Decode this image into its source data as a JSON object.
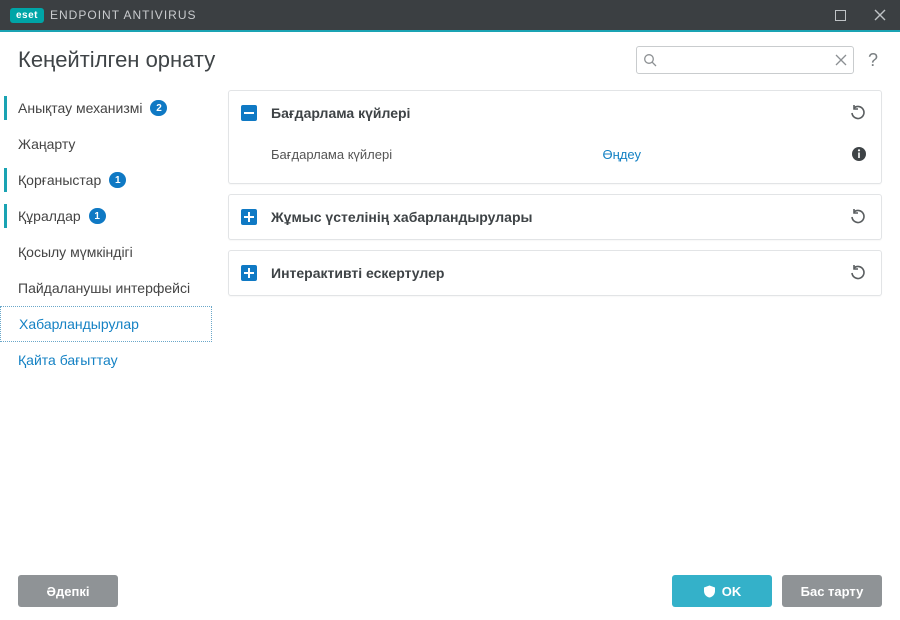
{
  "titlebar": {
    "brand_logo": "eset",
    "brand_text": "ENDPOINT ANTIVIRUS"
  },
  "header": {
    "title": "Кеңейтілген орнату",
    "search_placeholder": "",
    "search_value": ""
  },
  "sidebar": {
    "items": [
      {
        "label": "Анықтау механизмі",
        "badge": "2"
      },
      {
        "label": "Жаңарту",
        "badge": ""
      },
      {
        "label": "Қорғаныстар",
        "badge": "1"
      },
      {
        "label": "Құралдар",
        "badge": "1"
      },
      {
        "label": "Қосылу мүмкіндігі",
        "badge": ""
      },
      {
        "label": "Пайдаланушы интерфейсі",
        "badge": ""
      },
      {
        "label": "Хабарландырулар",
        "badge": ""
      },
      {
        "label": "Қайта бағыттау",
        "badge": ""
      }
    ]
  },
  "panels": {
    "p0": {
      "title": "Бағдарлама күйлері",
      "row_label": "Бағдарлама күйлері",
      "row_action": "Өңдеу"
    },
    "p1": {
      "title": "Жұмыс үстелінің хабарландырулары"
    },
    "p2": {
      "title": "Интерактивті ескертулер"
    }
  },
  "footer": {
    "default": "Әдепкі",
    "ok": "OK",
    "cancel": "Бас тарту"
  }
}
